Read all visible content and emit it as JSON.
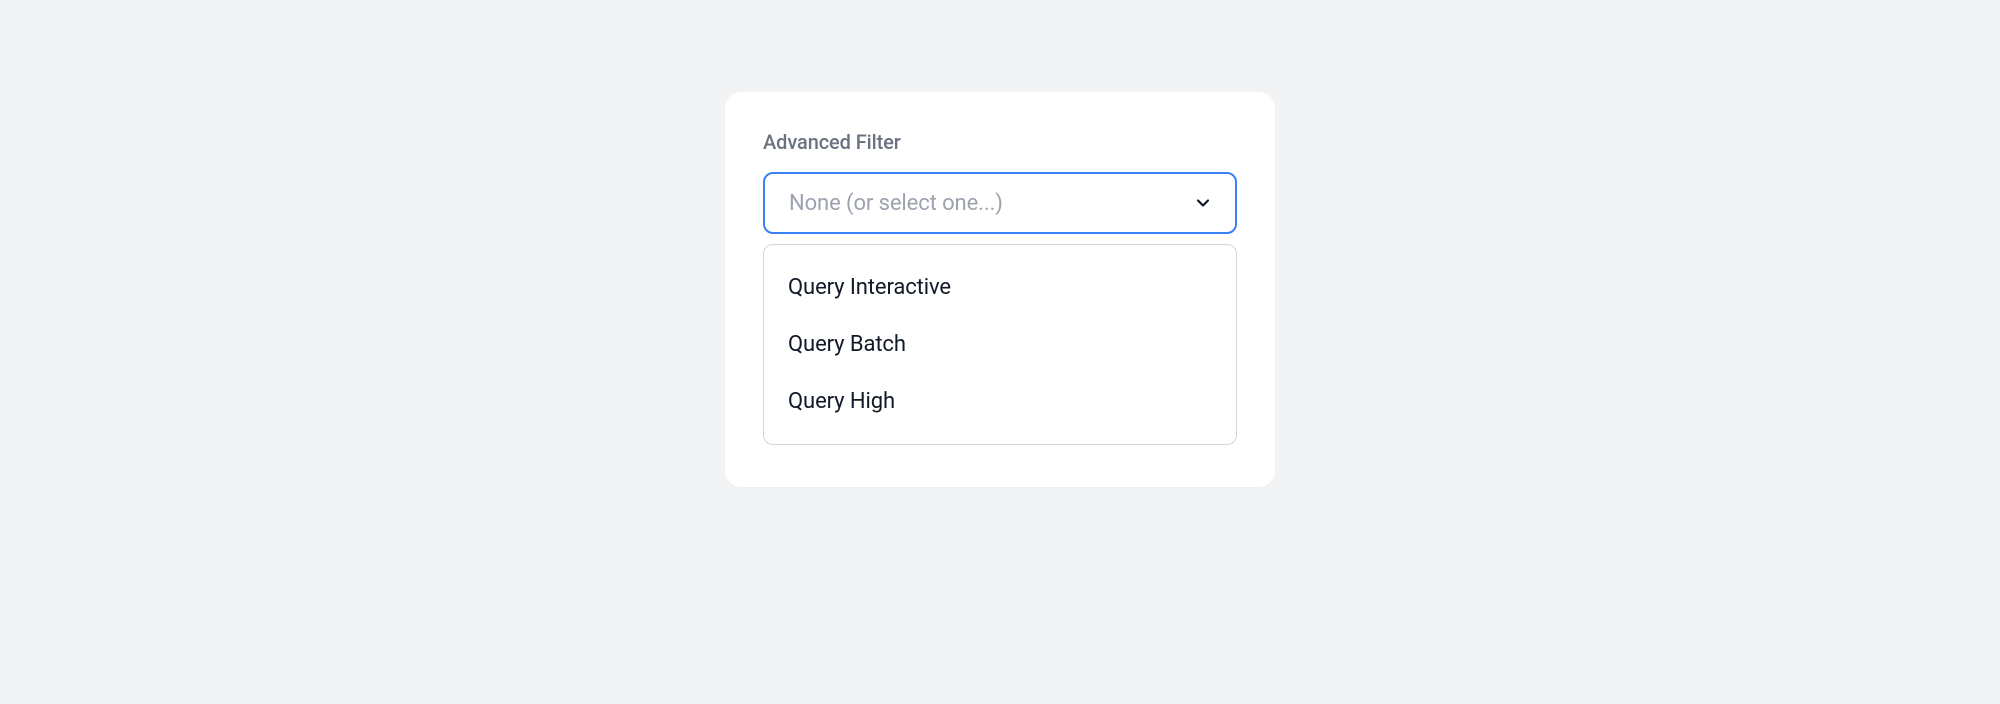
{
  "filter": {
    "label": "Advanced Filter",
    "placeholder": "None (or select one...)",
    "options": [
      "Query Interactive",
      "Query Batch",
      "Query High"
    ]
  }
}
